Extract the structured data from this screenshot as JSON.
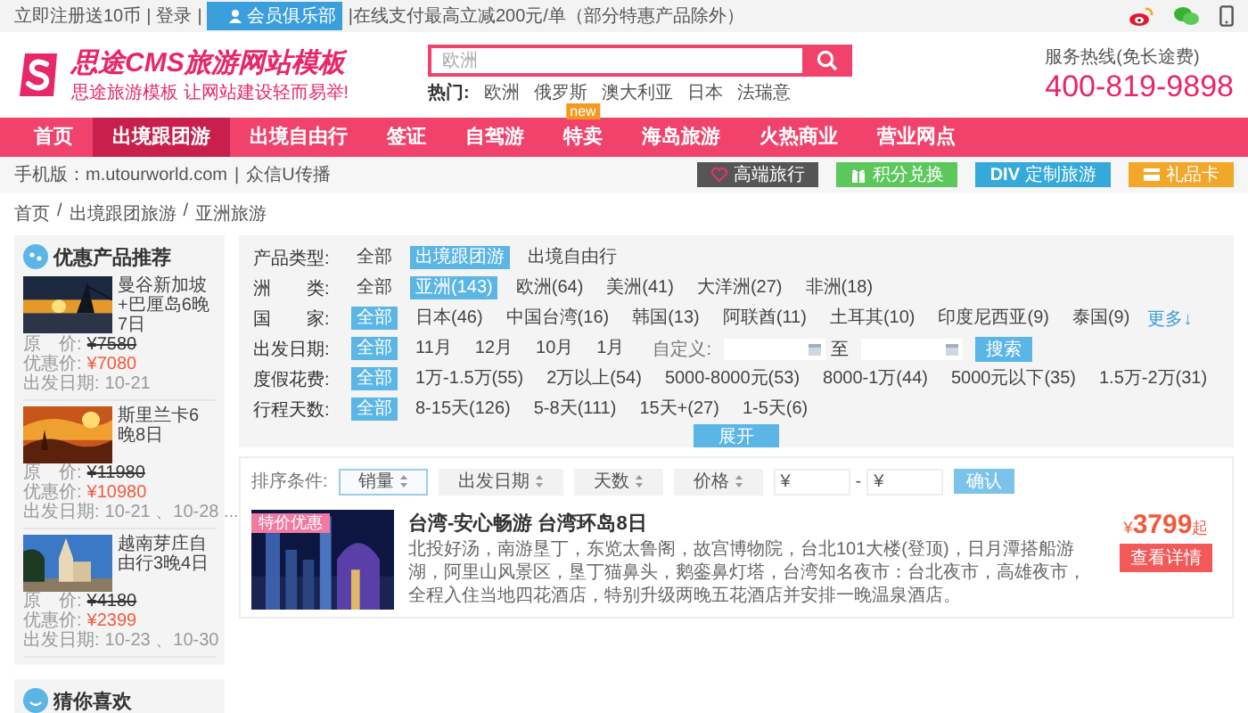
{
  "top_bar": {
    "items": [
      "立即注册送10币",
      "|",
      "登录",
      "|"
    ],
    "member_button": "会员俱乐部",
    "promo": "|在线支付最高立减200元/单（部分特惠产品除外）"
  },
  "header": {
    "logo_title": "思途CMS旅游网站模板",
    "tagline": "思途旅游模板 让网站建设轻而易举!",
    "search": {
      "placeholder": "欧洲"
    },
    "hot_label": "热门:",
    "hot_keywords": [
      "欧洲",
      "俄罗斯",
      "澳大利亚",
      "日本",
      "法瑞意"
    ],
    "hotline_label": "服务热线(免长途费)",
    "hotline": "400-819-9898"
  },
  "nav": [
    {
      "label": "首页",
      "selected": false
    },
    {
      "label": "出境跟团游",
      "selected": true
    },
    {
      "label": "出境自由行",
      "selected": false
    },
    {
      "label": "签证",
      "selected": false
    },
    {
      "label": "自驾游",
      "selected": false
    },
    {
      "label": "特卖",
      "selected": false,
      "badge": "new"
    },
    {
      "label": "海岛旅游",
      "selected": false
    },
    {
      "label": "火热商业",
      "selected": false
    },
    {
      "label": "营业网点",
      "selected": false
    }
  ],
  "sub_bar": {
    "mobile": "手机版：m.utourworld.com",
    "separator": "|",
    "wechat_text": "众信U传播",
    "buttons": [
      {
        "kind": "heart",
        "label": "高端旅行",
        "color": "#555555"
      },
      {
        "kind": "gift",
        "label": "积分兑换",
        "color": "#5cc85c"
      },
      {
        "kind": "div",
        "prefix": "DIV",
        "label": "定制旅游",
        "color": "#35a9d9"
      },
      {
        "kind": "card",
        "label": "礼品卡",
        "color": "#f2a728"
      }
    ]
  },
  "breadcrumb": [
    "首页",
    "/",
    "出境跟团旅游",
    "/",
    "亚洲旅游"
  ],
  "sidebar": {
    "title": "优惠产品推荐",
    "items": [
      {
        "title": "曼谷新加坡+巴厘岛6晚7日",
        "original_label": "原　价:",
        "original_price": "¥7580",
        "sale_label": "优惠价:",
        "sale_price": "¥7080",
        "date_label": "出发日期:",
        "dates": "10-21"
      },
      {
        "title": "斯里兰卡6晚8日",
        "original_label": "原　价:",
        "original_price": "¥11980",
        "sale_label": "优惠价:",
        "sale_price": "¥10980",
        "date_label": "出发日期:",
        "dates": "10-21 、10-28 ..."
      },
      {
        "title": "越南芽庄自由行3晚4日",
        "original_label": "原　价:",
        "original_price": "¥4180",
        "sale_label": "优惠价:",
        "sale_price": "¥2399",
        "date_label": "出发日期:",
        "dates": "10-23 、10-30"
      }
    ],
    "second_title": "猜你喜欢"
  },
  "filters": {
    "rows": [
      {
        "label": "产品类型:",
        "options": [
          {
            "text": "全部",
            "selected": false
          },
          {
            "text": "出境跟团游",
            "selected": true
          },
          {
            "text": "出境自由行",
            "selected": false
          }
        ]
      },
      {
        "label": "洲　　类:",
        "options": [
          {
            "text": "全部",
            "selected": false
          },
          {
            "text": "亚洲(143)",
            "selected": true
          },
          {
            "text": "欧洲(64)",
            "selected": false
          },
          {
            "text": "美洲(41)",
            "selected": false
          },
          {
            "text": "大洋洲(27)",
            "selected": false
          },
          {
            "text": "非洲(18)",
            "selected": false
          }
        ]
      },
      {
        "label": "国　　家:",
        "options": [
          {
            "text": "全部",
            "selected": true
          },
          {
            "text": "日本(46)",
            "selected": false
          },
          {
            "text": "中国台湾(16)",
            "selected": false
          },
          {
            "text": "韩国(13)",
            "selected": false
          },
          {
            "text": "阿联酋(11)",
            "selected": false
          },
          {
            "text": "土耳其(10)",
            "selected": false
          },
          {
            "text": "印度尼西亚(9)",
            "selected": false
          },
          {
            "text": "泰国(9)",
            "selected": false
          }
        ],
        "more": "更多↓"
      },
      {
        "label": "出发日期:",
        "options": [
          {
            "text": "全部",
            "selected": true
          },
          {
            "text": "11月",
            "selected": false
          },
          {
            "text": "12月",
            "selected": false
          },
          {
            "text": "10月",
            "selected": false
          },
          {
            "text": "1月",
            "selected": false
          }
        ],
        "custom": {
          "label": "自定义:",
          "to": "至",
          "button": "搜索"
        }
      },
      {
        "label": "度假花费:",
        "options": [
          {
            "text": "全部",
            "selected": true
          },
          {
            "text": "1万-1.5万(55)",
            "selected": false
          },
          {
            "text": "2万以上(54)",
            "selected": false
          },
          {
            "text": "5000-8000元(53)",
            "selected": false
          },
          {
            "text": "8000-1万(44)",
            "selected": false
          },
          {
            "text": "5000元以下(35)",
            "selected": false
          },
          {
            "text": "1.5万-2万(31)",
            "selected": false
          }
        ]
      },
      {
        "label": "行程天数:",
        "options": [
          {
            "text": "全部",
            "selected": true
          },
          {
            "text": "8-15天(126)",
            "selected": false
          },
          {
            "text": "5-8天(111)",
            "selected": false
          },
          {
            "text": "15天+(27)",
            "selected": false
          },
          {
            "text": "1-5天(6)",
            "selected": false
          }
        ]
      }
    ],
    "expand_button": "展开"
  },
  "sort_bar": {
    "label": "排序条件:",
    "options": [
      {
        "text": "销量",
        "selected": true
      },
      {
        "text": "出发日期",
        "selected": false
      },
      {
        "text": "天数",
        "selected": false
      },
      {
        "text": "价格",
        "selected": false
      }
    ],
    "currency": "¥",
    "dash": "-",
    "confirm": "确认"
  },
  "product": {
    "badge": "特价优惠",
    "title": "台湾-安心畅游 台湾环岛8日",
    "description": "北投好汤，南游垦丁，东览太鲁阁，故宫博物院，台北101大楼(登顶)，日月潭搭船游湖，阿里山风景区，垦丁猫鼻头，鹅銮鼻灯塔，台湾知名夜市：台北夜市，高雄夜市，全程入住当地四花酒店，特别升级两晚五花酒店并安排一晚温泉酒店。",
    "currency": "¥",
    "price": "3799",
    "price_suffix": "起",
    "details_button": "查看详情"
  }
}
